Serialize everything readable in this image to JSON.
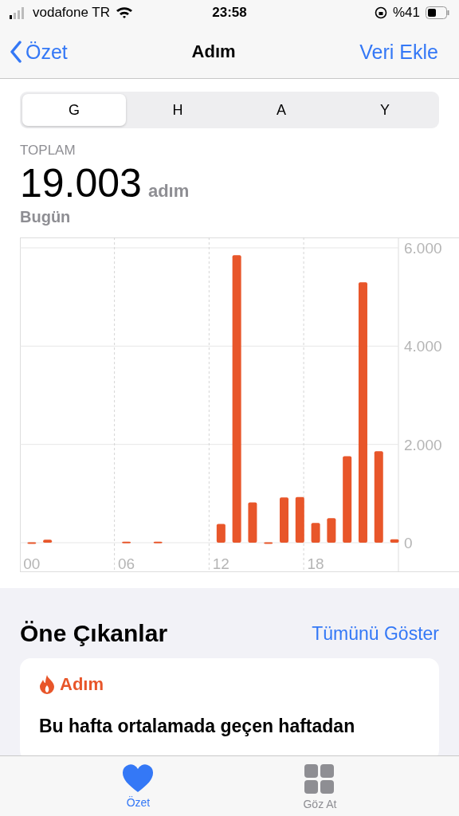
{
  "status_bar": {
    "carrier": "vodafone TR",
    "time": "23:58",
    "battery": "%41"
  },
  "nav": {
    "back": "Özet",
    "title": "Adım",
    "action": "Veri Ekle"
  },
  "segments": [
    {
      "label": "G",
      "selected": true
    },
    {
      "label": "H",
      "selected": false
    },
    {
      "label": "A",
      "selected": false
    },
    {
      "label": "Y",
      "selected": false
    }
  ],
  "summary": {
    "label": "TOPLAM",
    "value": "19.003",
    "unit": "adım",
    "period": "Bugün"
  },
  "chart": {
    "chart_data": {
      "type": "bar",
      "x": [
        0,
        1,
        2,
        3,
        4,
        5,
        6,
        7,
        8,
        9,
        10,
        11,
        12,
        13,
        14,
        15,
        16,
        17,
        18,
        19,
        20,
        21,
        22,
        23
      ],
      "series": [
        {
          "color": "#e8562a",
          "values": [
            10,
            60,
            0,
            0,
            0,
            0,
            20,
            0,
            20,
            0,
            0,
            0,
            380,
            5850,
            820,
            10,
            920,
            930,
            400,
            500,
            1760,
            5300,
            1860,
            70
          ]
        }
      ],
      "xlim": [
        -0.75,
        23.25
      ],
      "ylim": [
        0,
        6000
      ],
      "yticks": [
        {
          "value": 0,
          "label": "0"
        },
        {
          "value": 2000,
          "label": "2.000"
        },
        {
          "value": 4000,
          "label": "4.000"
        },
        {
          "value": 6000,
          "label": "6.000"
        }
      ],
      "xticks": [
        {
          "value": 0,
          "label": "00"
        },
        {
          "value": 6,
          "label": "06"
        },
        {
          "value": 12,
          "label": "12"
        },
        {
          "value": 18,
          "label": "18"
        }
      ]
    }
  },
  "highlights": {
    "title": "Öne Çıkanlar",
    "link": "Tümünü Göster",
    "card": {
      "category": "Adım",
      "text": "Bu hafta ortalamada geçen haftadan"
    }
  },
  "tab_bar": [
    {
      "label": "Özet",
      "selected": true
    },
    {
      "label": "Göz At",
      "selected": false
    }
  ]
}
